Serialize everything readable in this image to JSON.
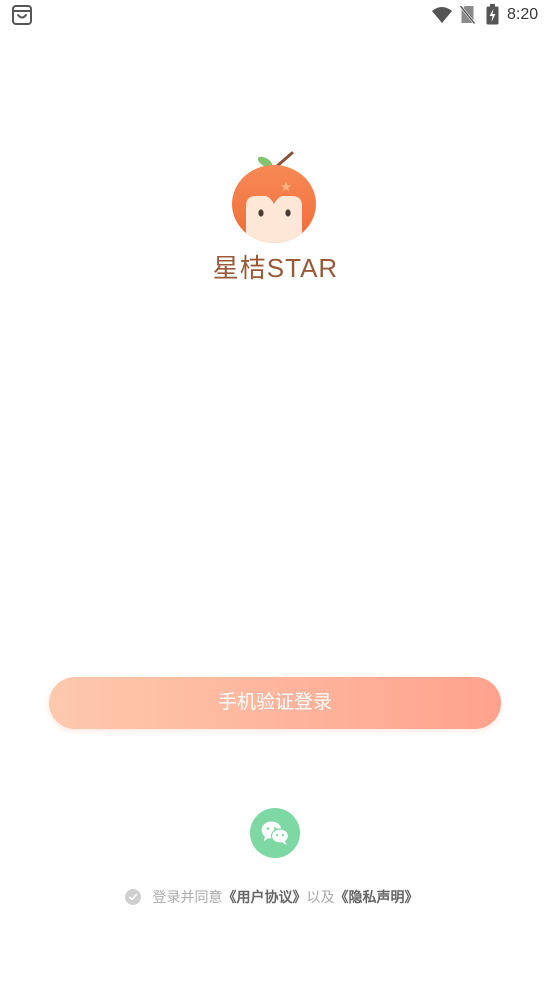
{
  "status_bar": {
    "time": "8:20",
    "left_icon": "app-notification-icon",
    "right_icons": [
      "wifi-icon",
      "no-sim-icon",
      "battery-charging-icon"
    ]
  },
  "logo": {
    "mascot_icon": "orange-mascot-icon",
    "brand_name": "星桔STAR"
  },
  "login": {
    "phone_button_label": "手机验证登录"
  },
  "social_login": {
    "wechat_icon": "wechat-icon"
  },
  "agreement": {
    "checkbox_icon": "check-circle-icon",
    "prefix": "登录并同意",
    "user_agreement_link": "《用户协议》",
    "conjunction": "以及",
    "privacy_link": "《隐私声明》"
  },
  "colors": {
    "brand_brown": "#9a5a3a",
    "button_gradient_start": "#fdc9ad",
    "button_gradient_end": "#ffa28d",
    "button_text": "#ffffff",
    "wechat_green": "#7dd8a3",
    "mascot_orange": "#f5804f",
    "muted_text": "#aaaaaa",
    "link_text": "#666666"
  }
}
